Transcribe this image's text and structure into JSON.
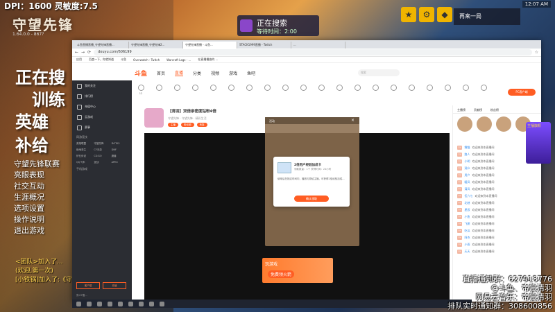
{
  "game": {
    "dpi_text": "DPI：1600 灵敏度:7.5",
    "title": "守望先锋",
    "version": "1.64.0.0 - 867?",
    "menu_big": [
      "正在搜",
      "训练",
      "英雄",
      "补给"
    ],
    "menu_small": [
      "守望先锋联赛",
      "亮眼表现",
      "社交互动",
      "生涯概况",
      "选项设置",
      "操作说明",
      "退出游戏"
    ],
    "chat": [
      "<团队>加入了...",
      "(欢迎,第一次)",
      "[小铁锅]加入了:《守..."
    ],
    "searching": "正在搜索",
    "wait_time": "等待时间：2:00",
    "rematch": "再来一局",
    "clock": "12:07 AM",
    "top_icons": [
      "award-icon",
      "settings-icon",
      "shield-icon"
    ]
  },
  "browser": {
    "tabs": [
      "斗鱼直播直播_守望先锋直播...",
      "守望先锋直播_守望先锋2...",
      "守望先锋直播 - 斗鱼...",
      "STACK1999直播 - Twitch",
      "..."
    ],
    "url": "douyu.com/606199",
    "bookmarks": [
      "应用",
      "百度一下，你就知道",
      "斗鱼",
      "Overwatch - Twitch",
      "Warcraft Logs - ...",
      "在直播播放的 ..."
    ]
  },
  "douyu": {
    "logo": "斗鱼",
    "nav": [
      "首页",
      "直播",
      "分类",
      "视频",
      "游戏",
      "鱼吧"
    ],
    "search_placeholder": "搜索",
    "pc_button": "PC客户端",
    "sidebar": {
      "items": [
        "我的关注",
        "排行榜",
        "充值中心",
        "云游戏",
        "赛事"
      ],
      "section_hot": "网游竞技",
      "games": [
        "英雄联盟",
        "守望先锋",
        "DOTA2",
        "绝地求生",
        "CF手游",
        "DNF",
        "炉石传说",
        "CS:GO",
        "魔兽",
        "QQ飞车",
        "逆战",
        "APEX"
      ],
      "section_mobile": "手机游戏",
      "bottom_buttons": [
        "客户端",
        "充值"
      ],
      "footer": "鲁ICP备..."
    },
    "categories": [
      "12",
      "",
      "",
      "",
      "",
      "",
      "",
      "",
      "",
      "",
      "",
      "",
      "",
      "",
      "",
      "",
      "",
      "",
      "",
      "",
      "",
      ""
    ],
    "room": {
      "title": "【清羽】双倍亲密度钻粉4倍",
      "tags": "守望先锋 · 守望先锋 · 精彩生活",
      "badges": [
        "主播",
        "粉丝团",
        "贵族"
      ],
      "id_label": "房间号 606199"
    },
    "ad": {
      "line1": "玩游戏",
      "line2": "免费领火箭"
    },
    "overlay": {
      "header": "活动",
      "card_title": "2倍用户经验加成卡",
      "card_sub": "领取数量：1个\n获得时间：24小时",
      "card_desc": "使用后在指定时间内，播放礼物给主播，可获得2倍经验加成...",
      "card_button": "确认领取"
    },
    "right": {
      "tabs": [
        "主播榜",
        "贡献榜",
        "粉丝榜"
      ],
      "chat": [
        {
          "lv": "Lv",
          "name": "霖猫",
          "msg": "欢迎来到本直播间"
        },
        {
          "lv": "Lv",
          "name": "路人",
          "msg": "欢迎来到本直播间"
        },
        {
          "lv": "Lv",
          "name": "小明",
          "msg": "欢迎来到本直播间"
        },
        {
          "lv": "Lv",
          "name": "观众",
          "msg": "欢迎来到本直播间"
        },
        {
          "lv": "Lv",
          "name": "用户",
          "msg": "欢迎来到本直播间"
        },
        {
          "lv": "Lv",
          "name": "暖风",
          "msg": "欢迎来到本直播间"
        },
        {
          "lv": "Lv",
          "name": "清风",
          "msg": "欢迎来到本直播间"
        },
        {
          "lv": "Lv",
          "name": "伍六七",
          "msg": "欢迎来到本直播间"
        },
        {
          "lv": "Lv",
          "name": "北巷",
          "msg": "欢迎来到本直播间"
        },
        {
          "lv": "Lv",
          "name": "星辰",
          "msg": "欢迎来到本直播间"
        },
        {
          "lv": "Lv",
          "name": "小鱼",
          "msg": "欢迎来到本直播间"
        },
        {
          "lv": "Lv",
          "name": "飞燕",
          "msg": "欢迎来到本直播间"
        },
        {
          "lv": "Lv",
          "name": "吃瓜",
          "msg": "欢迎来到本直播间"
        },
        {
          "lv": "Lv",
          "name": "阿杰",
          "msg": "欢迎来到本直播间"
        },
        {
          "lv": "Lv",
          "name": "小雨",
          "msg": "欢迎来到本直播间"
        },
        {
          "lv": "Lv",
          "name": "天天",
          "msg": "欢迎来到本直播间"
        }
      ],
      "gift_title": "主播旗帜"
    }
  },
  "stream_overlay": [
    "直播通知群：627918776",
    "@斗鱼、帝宸清羽",
    "网易云音乐：帝宸清羽",
    "排队实时通知群：308600856"
  ]
}
